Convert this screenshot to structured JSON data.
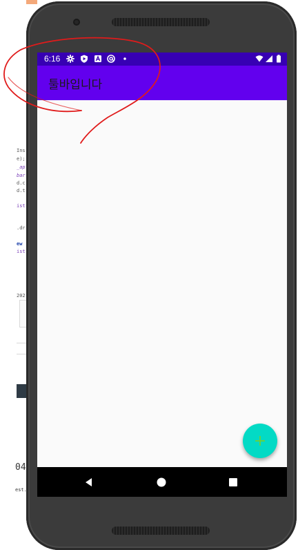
{
  "status_bar": {
    "time": "6:16",
    "icons": [
      "settings-icon",
      "play-protect-icon",
      "app-a-icon",
      "at-sign-icon",
      "dot-icon",
      "wifi-icon",
      "signal-icon",
      "battery-icon"
    ]
  },
  "app_bar": {
    "title": "툴바입니다"
  },
  "fab": {
    "label": "+"
  },
  "nav_bar": {
    "icons": [
      "back-icon",
      "home-icon",
      "recents-icon"
    ]
  },
  "background_ide": {
    "lines": [
      "Ins",
      "e);",
      "_ap",
      "bar",
      "d.c",
      "d.t",
      "ist",
      ".dr",
      "ew",
      "ist",
      "202",
      "04",
      "est."
    ]
  },
  "colors": {
    "status_bar": "#3700b3",
    "app_bar": "#6200ee",
    "fab": "#03dac5",
    "annotation": "#e01b1b"
  }
}
